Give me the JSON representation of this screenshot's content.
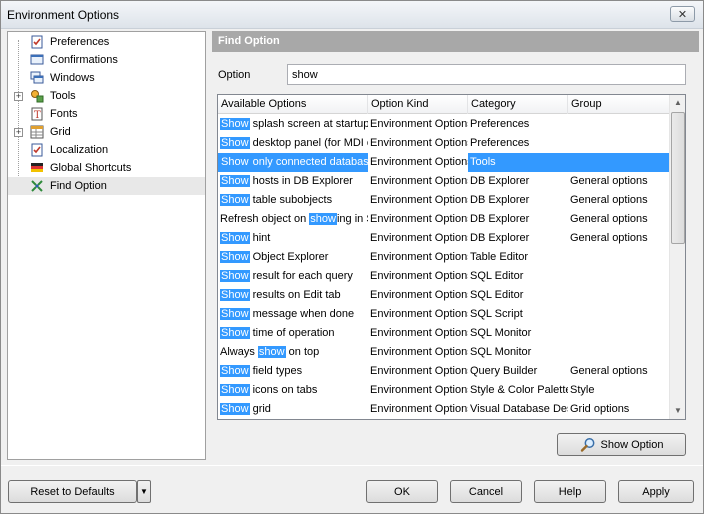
{
  "window": {
    "title": "Environment Options",
    "close_glyph": "✕"
  },
  "tree": {
    "items": [
      {
        "label": "Preferences",
        "icon": "preferences-icon",
        "expander": ""
      },
      {
        "label": "Confirmations",
        "icon": "confirmations-icon",
        "expander": ""
      },
      {
        "label": "Windows",
        "icon": "windows-icon",
        "expander": ""
      },
      {
        "label": "Tools",
        "icon": "tools-icon",
        "expander": "+"
      },
      {
        "label": "Fonts",
        "icon": "fonts-icon",
        "expander": ""
      },
      {
        "label": "Grid",
        "icon": "grid-icon",
        "expander": "+"
      },
      {
        "label": "Localization",
        "icon": "localization-icon",
        "expander": ""
      },
      {
        "label": "Global Shortcuts",
        "icon": "shortcuts-icon",
        "expander": ""
      },
      {
        "label": "Find Option",
        "icon": "find-option-icon",
        "expander": ""
      }
    ]
  },
  "panel": {
    "header": "Find Option"
  },
  "search": {
    "label": "Option",
    "value": "show"
  },
  "grid": {
    "columns": [
      "Available Options",
      "Option Kind",
      "Category",
      "Group"
    ],
    "rows": [
      {
        "pre": "",
        "hl": "Show",
        "post": " splash screen at startup",
        "kind": "Environment Options",
        "category": "Preferences",
        "group": ""
      },
      {
        "pre": "",
        "hl": "Show",
        "post": " desktop panel (for MDI environment)",
        "kind": "Environment Options",
        "category": "Preferences",
        "group": ""
      },
      {
        "pre": "",
        "hl": "Show",
        "post": " only connected databases",
        "kind": "Environment Options",
        "category": "Tools",
        "group": "",
        "selected": true
      },
      {
        "pre": "",
        "hl": "Show",
        "post": " hosts in DB Explorer",
        "kind": "Environment Options",
        "category": "DB Explorer",
        "group": "General options"
      },
      {
        "pre": "",
        "hl": "Show",
        "post": " table subobjects",
        "kind": "Environment Options",
        "category": "DB Explorer",
        "group": "General options"
      },
      {
        "pre": "Refresh object on ",
        "hl": "show",
        "post": "ing in Structure",
        "kind": "Environment Options",
        "category": "DB Explorer",
        "group": "General options"
      },
      {
        "pre": "",
        "hl": "Show",
        "post": " hint",
        "kind": "Environment Options",
        "category": "DB Explorer",
        "group": "General options"
      },
      {
        "pre": "",
        "hl": "Show",
        "post": " Object Explorer",
        "kind": "Environment Options",
        "category": "Table Editor",
        "group": ""
      },
      {
        "pre": "",
        "hl": "Show",
        "post": " result for each query",
        "kind": "Environment Options",
        "category": "SQL Editor",
        "group": ""
      },
      {
        "pre": "",
        "hl": "Show",
        "post": " results on Edit tab",
        "kind": "Environment Options",
        "category": "SQL Editor",
        "group": ""
      },
      {
        "pre": "",
        "hl": "Show",
        "post": " message when done",
        "kind": "Environment Options",
        "category": "SQL Script",
        "group": ""
      },
      {
        "pre": "",
        "hl": "Show",
        "post": " time of operation",
        "kind": "Environment Options",
        "category": "SQL Monitor",
        "group": ""
      },
      {
        "pre": "Always ",
        "hl": "show",
        "post": " on top",
        "kind": "Environment Options",
        "category": "SQL Monitor",
        "group": ""
      },
      {
        "pre": "",
        "hl": "Show",
        "post": " field types",
        "kind": "Environment Options",
        "category": "Query Builder",
        "group": "General options"
      },
      {
        "pre": "",
        "hl": "Show",
        "post": " icons on tabs",
        "kind": "Environment Options",
        "category": "Style & Color Palette",
        "group": "Style"
      },
      {
        "pre": "",
        "hl": "Show",
        "post": " grid",
        "kind": "Environment Options",
        "category": "Visual Database Designer",
        "group": "Grid options"
      }
    ]
  },
  "buttons": {
    "show_option": "Show Option",
    "reset": "Reset to Defaults",
    "ok": "OK",
    "cancel": "Cancel",
    "help": "Help",
    "apply": "Apply"
  }
}
